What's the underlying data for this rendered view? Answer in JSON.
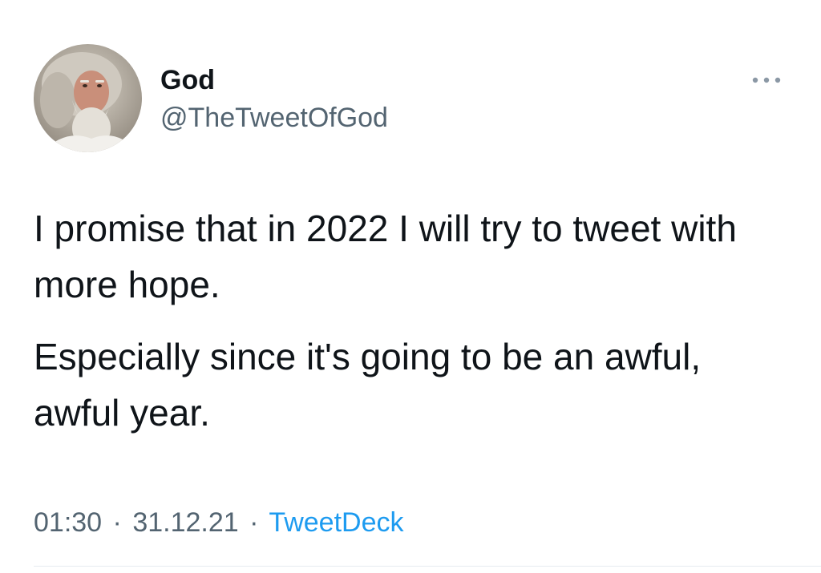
{
  "author": {
    "display_name": "God",
    "handle": "@TheTweetOfGod",
    "avatar_icon": "bearded-man-avatar"
  },
  "more_icon": "more-horizontal-icon",
  "tweet": {
    "paragraphs": [
      "I promise that in 2022 I will try to tweet with more hope.",
      "Especially since it's going to be an awful, awful year."
    ]
  },
  "meta": {
    "time": "01:30",
    "separator": "·",
    "date": "31.12.21",
    "source": "TweetDeck"
  },
  "colors": {
    "text": "#0f1419",
    "secondary": "#536471",
    "link": "#1d9bf0",
    "divider": "#e6ecf0"
  }
}
